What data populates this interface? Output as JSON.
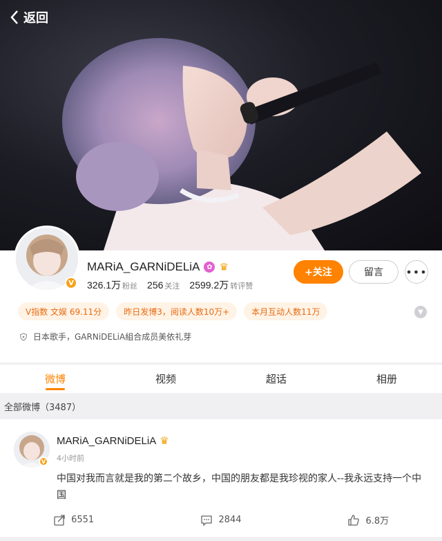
{
  "header": {
    "back_label": "返回"
  },
  "profile": {
    "name": "MARiA_GARNiDELiA",
    "verified_badge": "V",
    "stats": [
      {
        "value": "326.1万",
        "label": "粉丝"
      },
      {
        "value": "256",
        "label": "关注"
      },
      {
        "value": "2599.2万",
        "label": "转评赞"
      }
    ],
    "follow_label": "+关注",
    "message_label": "留言",
    "more_label": "•••",
    "chips": [
      "V指数 文娱 69.11分",
      "昨日发博3，阅读人数10万+",
      "本月互动人数11万"
    ],
    "description": "日本歌手，GARNiDELiA組合成员美依礼芽"
  },
  "tabs": [
    "微博",
    "视频",
    "超话",
    "相册"
  ],
  "active_tab": "微博",
  "section_title": "全部微博（3487）",
  "post": {
    "author": "MARiA_GARNiDELiA",
    "time": "4小时前",
    "text": "中国对我而言就是我的第二个故乡，中国的朋友都是我珍视的家人--我永远支持一个中国",
    "reposts": "6551",
    "comments": "2844",
    "likes": "6.8万"
  },
  "colors": {
    "accent": "#ff8200",
    "chip_bg": "#fff3e6",
    "chip_text": "#e86a10"
  },
  "icons": [
    "back-chevron-icon",
    "pink-badge-icon",
    "crown-icon",
    "expand-chevron-icon",
    "shield-icon",
    "share-icon",
    "comment-icon",
    "like-icon"
  ]
}
